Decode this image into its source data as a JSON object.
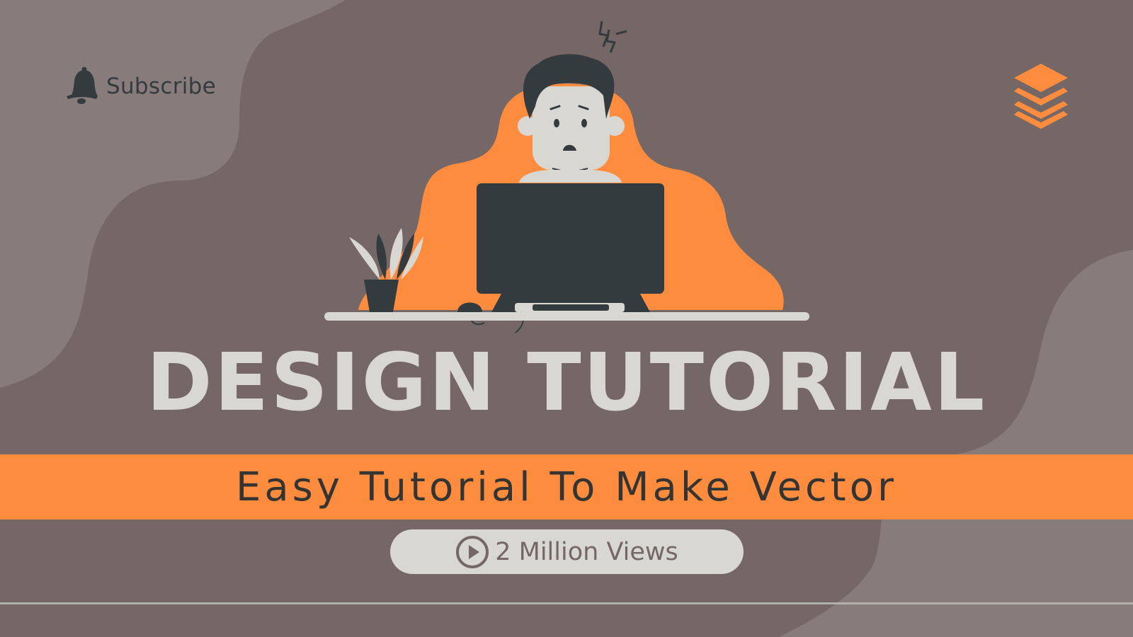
{
  "colors": {
    "background": "#756766",
    "background_blob": "#877c7b",
    "accent_orange": "#fe8c3e",
    "dark": "#343b3e",
    "light": "#d8d7d2"
  },
  "subscribe": {
    "icon": "bell-icon",
    "label": "Subscribe"
  },
  "brand": {
    "icon": "layers-stack-icon"
  },
  "illustration": {
    "subject": "stressed-person-at-computer"
  },
  "hero": {
    "title": "DESIGN TUTORIAL",
    "subtitle": "Easy Tutorial To Make Vector"
  },
  "views": {
    "icon": "play-circle-icon",
    "label": "2 Million Views"
  }
}
